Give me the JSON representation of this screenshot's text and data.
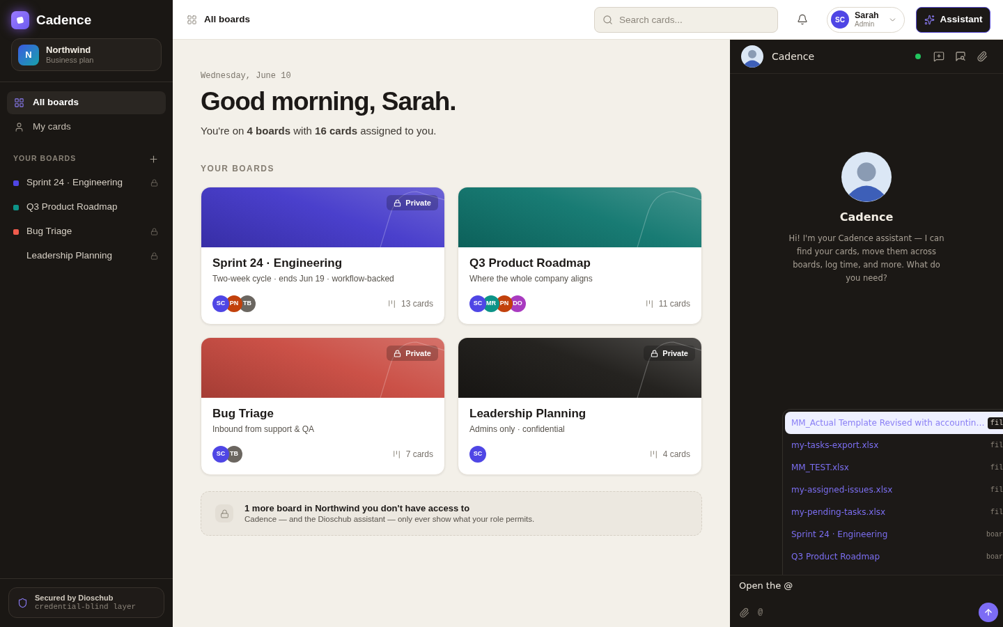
{
  "sidebar": {
    "brand": "Cadence",
    "workspace": {
      "initial": "N",
      "name": "Northwind",
      "plan": "Business plan"
    },
    "nav": [
      {
        "kind": "grid",
        "label": "All boards",
        "selected": true
      },
      {
        "kind": "user",
        "label": "My cards",
        "selected": false
      }
    ],
    "boards_heading": "YOUR BOARDS",
    "boards": [
      {
        "name": "Sprint 24 · Engineering",
        "color": "#4f46e5",
        "locked": true
      },
      {
        "name": "Q3 Product Roadmap",
        "color": "#0d9488",
        "locked": false
      },
      {
        "name": "Bug Triage",
        "color": "#ef5b4c",
        "locked": true
      },
      {
        "name": "Leadership Planning",
        "locked": true
      }
    ],
    "security": {
      "title": "Secured by Dioschub",
      "subtitle": "credential-blind layer"
    }
  },
  "header": {
    "title": "All boards",
    "search": {
      "placeholder": "Search cards..."
    },
    "user": {
      "initials": "SC",
      "name": "Sarah",
      "role": "Admin"
    },
    "assistant_button": "Assistant"
  },
  "main": {
    "date": "Wednesday, June 10",
    "greeting": "Good morning, Sarah.",
    "summary": "You're on **4 boards** with **16 cards** assigned to you.",
    "section_title": "YOUR BOARDS",
    "boards": [
      {
        "title": "Sprint 24 · Engineering",
        "description": "Two-week cycle · ends Jun 19 · workflow-backed",
        "color": "#4338ca",
        "badge": "Private",
        "members": [
          {
            "initials": "SC",
            "color": "#4f46e5"
          },
          {
            "initials": "PN",
            "color": "#c2410c"
          },
          {
            "initials": "TB",
            "color": "#6b6660"
          }
        ],
        "count": "13 cards"
      },
      {
        "title": "Q3 Product Roadmap",
        "description": "Where the whole company aligns",
        "color": "#0f766e",
        "members": [
          {
            "initials": "SC",
            "color": "#4f46e5"
          },
          {
            "initials": "MR",
            "color": "#0d9488"
          },
          {
            "initials": "PN",
            "color": "#c2410c"
          },
          {
            "initials": "DO",
            "color": "#a93bc0"
          }
        ],
        "count": "11 cards"
      },
      {
        "title": "Bug Triage",
        "description": "Inbound from support & QA",
        "color": "#c94a40",
        "badge": "Private",
        "members": [
          {
            "initials": "SC",
            "color": "#4f46e5"
          },
          {
            "initials": "TB",
            "color": "#6b6660"
          }
        ],
        "count": "7 cards"
      },
      {
        "title": "Leadership Planning",
        "description": "Admins only · confidential",
        "color": "#1c1a17",
        "badge": "Private",
        "members": [
          {
            "initials": "SC",
            "color": "#4f46e5"
          }
        ],
        "count": "4 cards"
      }
    ],
    "locked_notice": {
      "title": "1 more board in Northwind you don't have access to",
      "body": "Cadence — and the Dioschub assistant — only ever show what your role permits."
    }
  },
  "assistant": {
    "name": "Cadence",
    "online": true,
    "intro_name": "Cadence",
    "intro": "Hi! I'm your Cadence assistant — I can find your cards, move them across boards, log time, and more. What do you need?",
    "mentions": [
      {
        "label": "MM_Actual Template Revised with accountin…",
        "type": "fil",
        "selected": true
      },
      {
        "label": "my-tasks-export.xlsx",
        "type": "fil",
        "selected": false
      },
      {
        "label": "MM_TEST.xlsx",
        "type": "fil",
        "selected": false
      },
      {
        "label": "my-assigned-issues.xlsx",
        "type": "fil",
        "selected": false
      },
      {
        "label": "my-pending-tasks.xlsx",
        "type": "fil",
        "selected": false
      },
      {
        "label": "Sprint 24 · Engineering",
        "type": "boar",
        "selected": false
      },
      {
        "label": "Q3 Product Roadmap",
        "type": "boar",
        "selected": false
      }
    ],
    "composer": {
      "value": "Open the @",
      "mention_key": "@"
    }
  }
}
